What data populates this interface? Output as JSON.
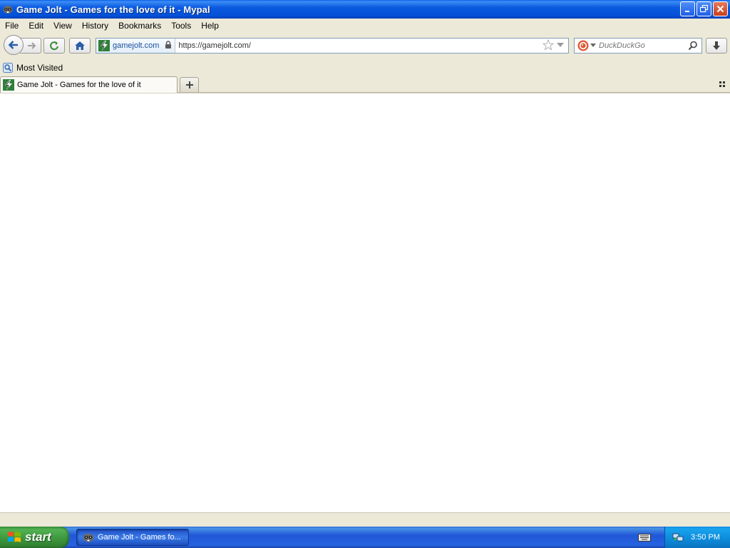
{
  "window": {
    "title": "Game Jolt - Games for the love of it - Mypal",
    "buttons": [
      "minimize",
      "restore",
      "close"
    ]
  },
  "menu": [
    "File",
    "Edit",
    "View",
    "History",
    "Bookmarks",
    "Tools",
    "Help"
  ],
  "navigation": {
    "site_identity": "gamejolt.com",
    "url": "https://gamejolt.com/",
    "search_placeholder": "DuckDuckGo"
  },
  "bookmarks": {
    "items": [
      "Most Visited"
    ]
  },
  "tabs": [
    {
      "title": "Game Jolt - Games for the love of it",
      "active": true
    }
  ],
  "taskbar": {
    "start_label": "start",
    "task_label": "Game Jolt - Games fo...",
    "clock": "3:50 PM"
  },
  "colors": {
    "titlebar": "#0450d6",
    "chrome": "#ece9d8",
    "start_green": "#3c943c",
    "taskbar_blue": "#2157d7",
    "tray_blue": "#0c8ad9",
    "gamejolt_green": "#2f7f3a"
  },
  "icons": {
    "app": "mypal-raccoon-icon",
    "back": "back-arrow-icon",
    "forward": "forward-arrow-icon",
    "reload": "reload-icon",
    "home": "home-icon",
    "lock": "lock-icon",
    "bookmark_star": "star-icon",
    "search_engine": "duckduckgo-icon",
    "search_go": "magnifier-icon",
    "downloads": "download-arrow-icon",
    "all_tabs": "list-all-tabs-icon"
  }
}
